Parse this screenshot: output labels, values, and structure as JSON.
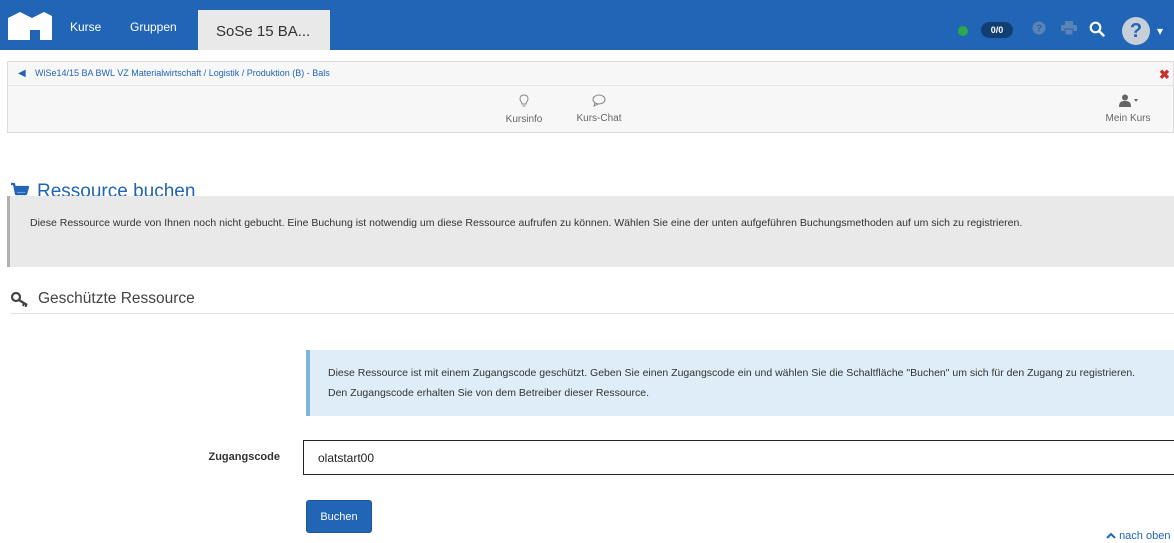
{
  "navbar": {
    "nav_items": [
      "Kurse",
      "Gruppen"
    ],
    "course_tab": "SoSe 15 BA...",
    "badge": "0/0",
    "icons": [
      "home-logo-icon",
      "status-dot-icon",
      "help-icon",
      "print-icon",
      "search-icon",
      "avatar-help-icon",
      "caret-down-icon"
    ],
    "colors": {
      "bar": "#2165b6",
      "status_dot": "#2ea84a",
      "badge": "#123f73"
    }
  },
  "breadcrumb": {
    "text": "WiSe14/15 BA BWL VZ Materialwirtschaft / Logistik / Produktion (B) - Bals",
    "close_icon": "close-icon"
  },
  "toolbar": {
    "kursinfo": "Kursinfo",
    "kurschat": "Kurs-Chat",
    "mein_kurs": "Mein Kurs"
  },
  "page": {
    "title": "Ressource buchen",
    "warning": "Diese Ressource wurde von Ihnen noch nicht gebucht. Eine Buchung ist notwendig um diese Ressource aufrufen zu können. Wählen Sie eine der unten aufgeführen Buchungsmethoden auf um sich zu registrieren.",
    "section_title": "Geschützte Ressource",
    "info": "Diese Ressource ist mit einem Zugangscode geschützt. Geben Sie einen Zugangscode ein und wählen Sie die Schaltfläche \"Buchen\" um sich für den Zugang zu registrieren. Den Zugangscode erhalten Sie von dem Betreiber dieser Ressource.",
    "label": "Zugangscode",
    "input_value": "olatstart00",
    "button": "Buchen",
    "top_link": "nach oben",
    "accent_color": "#2165b6"
  }
}
